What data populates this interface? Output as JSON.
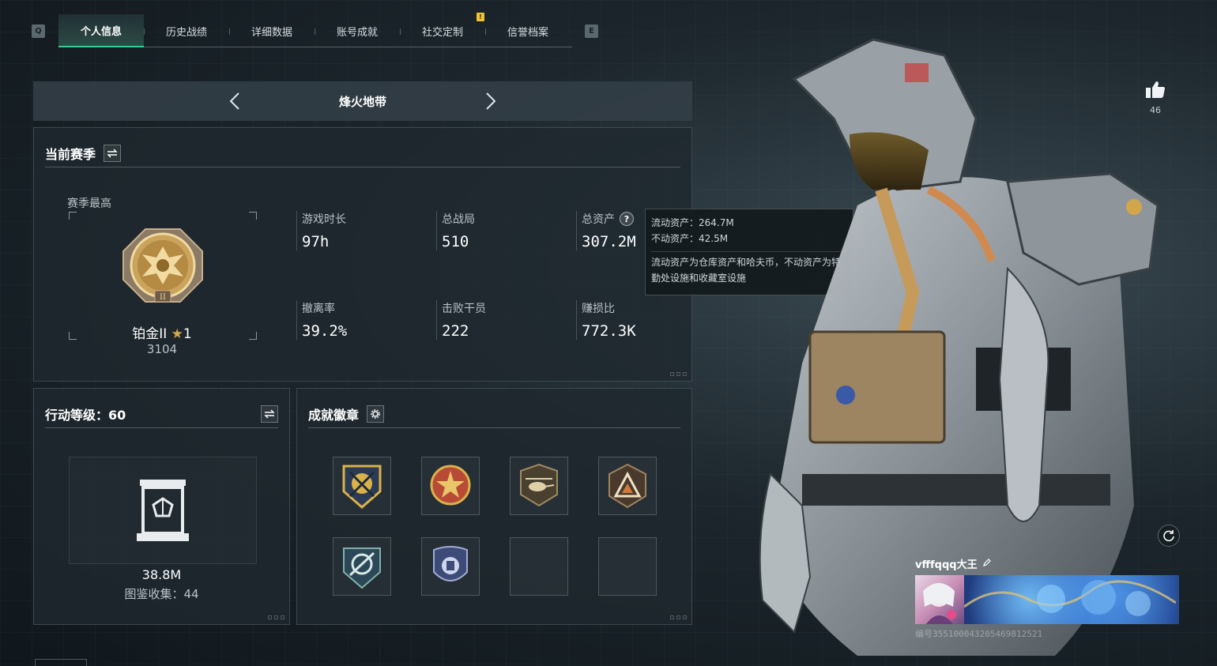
{
  "tabs": {
    "prev_key": "Q",
    "next_key": "E",
    "items": [
      "个人信息",
      "历史战绩",
      "详细数据",
      "账号成就",
      "社交定制",
      "信誉档案"
    ],
    "badge": "!"
  },
  "mode": {
    "title": "烽火地带"
  },
  "season": {
    "title": "当前赛季",
    "best_label": "赛季最高",
    "rank_name": "铂金II",
    "rank_stars": "1",
    "rank_score": "3104",
    "stats": {
      "playtime": {
        "label": "游戏时长",
        "value": "97h"
      },
      "matches": {
        "label": "总战局",
        "value": "510"
      },
      "assets": {
        "label": "总资产",
        "value": "307.2M"
      },
      "extract_rate": {
        "label": "撤离率",
        "value": "39.2%"
      },
      "kills": {
        "label": "击败干员",
        "value": "222"
      },
      "profit_ratio": {
        "label": "赚损比",
        "value": "772.3K"
      }
    }
  },
  "tooltip": {
    "liquid": "流动资产：264.7M",
    "fixed": "不动资产：42.5M",
    "desc": "流动资产为仓库资产和哈夫币，不动资产为特勤处设施和收藏室设施"
  },
  "level": {
    "title": "行动等级：60",
    "collection_value": "38.8M",
    "collection_count": "图鉴收集：44"
  },
  "achievements": {
    "title": "成就徽章",
    "badges": [
      {
        "icon": "crossed-rifles-badge-icon",
        "color": "#c9a23a"
      },
      {
        "icon": "star-shield-badge-icon",
        "color": "#b0503a"
      },
      {
        "icon": "helicopter-badge-icon",
        "color": "#8a7a5a"
      },
      {
        "icon": "triangle-badge-icon",
        "color": "#8a6a4a"
      },
      {
        "icon": "target-badge-icon",
        "color": "#3d6a78"
      },
      {
        "icon": "eagle-shield-badge-icon",
        "color": "#4b5a8a"
      },
      {
        "icon": "empty-slot",
        "color": ""
      },
      {
        "icon": "empty-slot",
        "color": ""
      }
    ]
  },
  "profile": {
    "likes": "46",
    "player_name": "vfffqqq大王",
    "player_id": "编号355100043205469812521"
  },
  "colors": {
    "accent": "#2fd190",
    "gold": "#d4a84a",
    "tab_badge": "#f1c232"
  }
}
